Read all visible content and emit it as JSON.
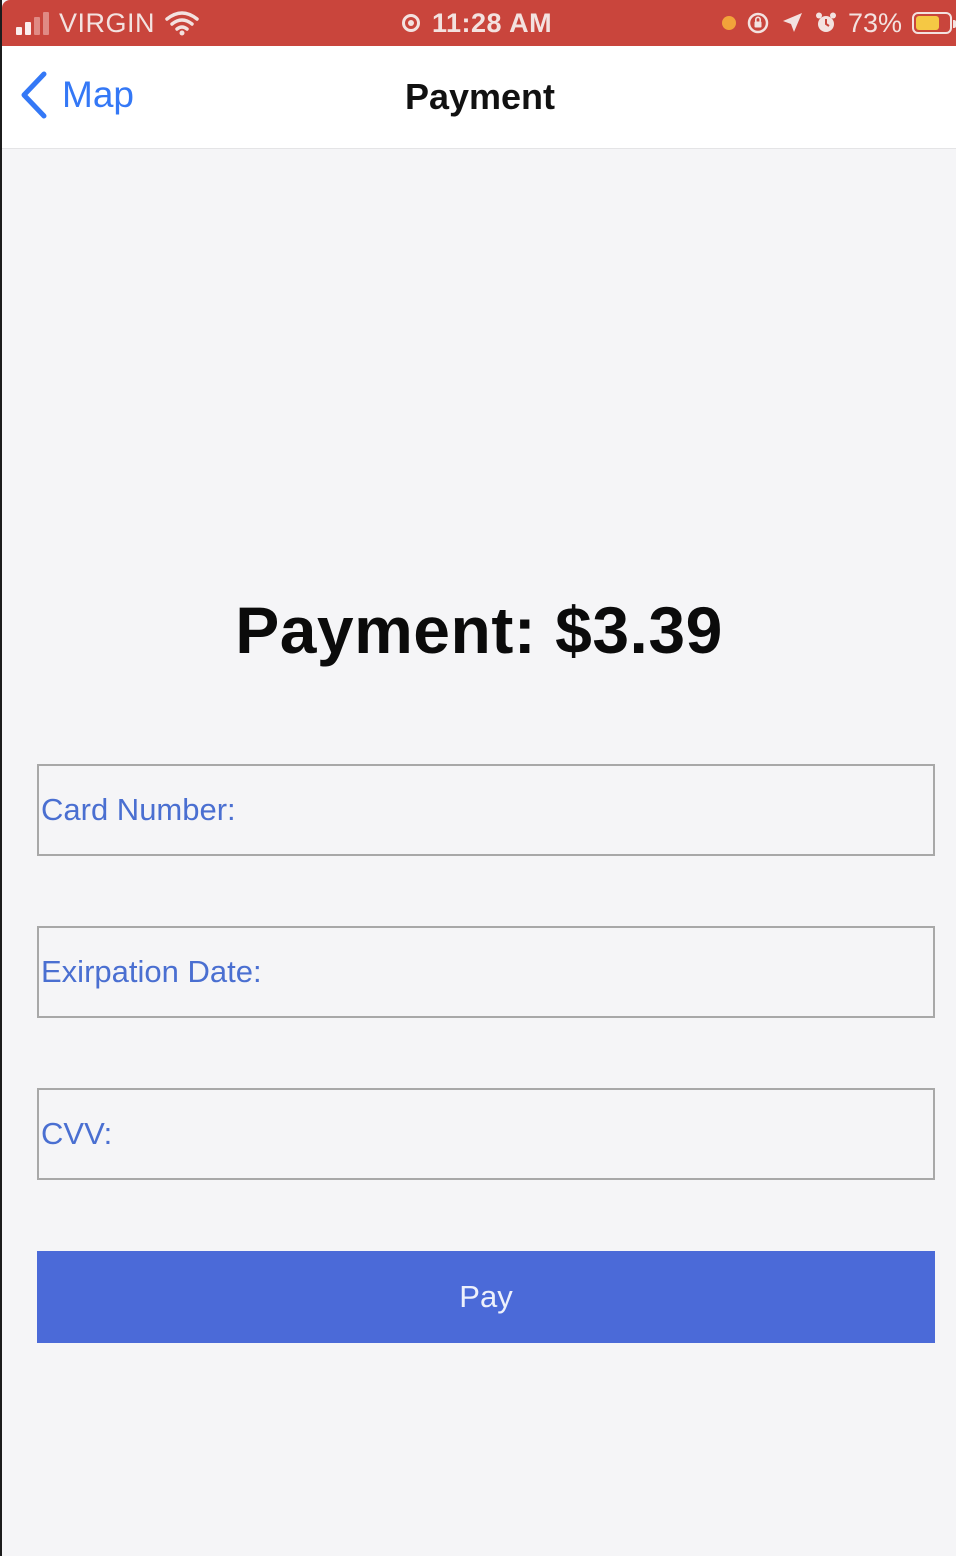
{
  "status_bar": {
    "carrier": "VIRGIN",
    "time": "11:28 AM",
    "battery_percent": "73%",
    "battery_level": 0.73,
    "icons": [
      "signal-icon",
      "wifi-icon",
      "screen-recording-icon",
      "orange-dot-indicator",
      "rotation-lock-icon",
      "location-icon",
      "alarm-icon",
      "battery-icon"
    ]
  },
  "nav": {
    "back_label": "Map",
    "title": "Payment"
  },
  "main": {
    "amount_text": "Payment: $3.39",
    "card_number_placeholder": "Card Number:",
    "expiration_placeholder": "Exirpation Date:",
    "cvv_placeholder": "CVV:",
    "pay_label": "Pay"
  },
  "colors": {
    "status_bar_bg": "#c9453c",
    "accent": "#3478f6",
    "button_bg": "#4b6ad8",
    "placeholder": "#4a6fd1",
    "background": "#f5f5f7"
  }
}
